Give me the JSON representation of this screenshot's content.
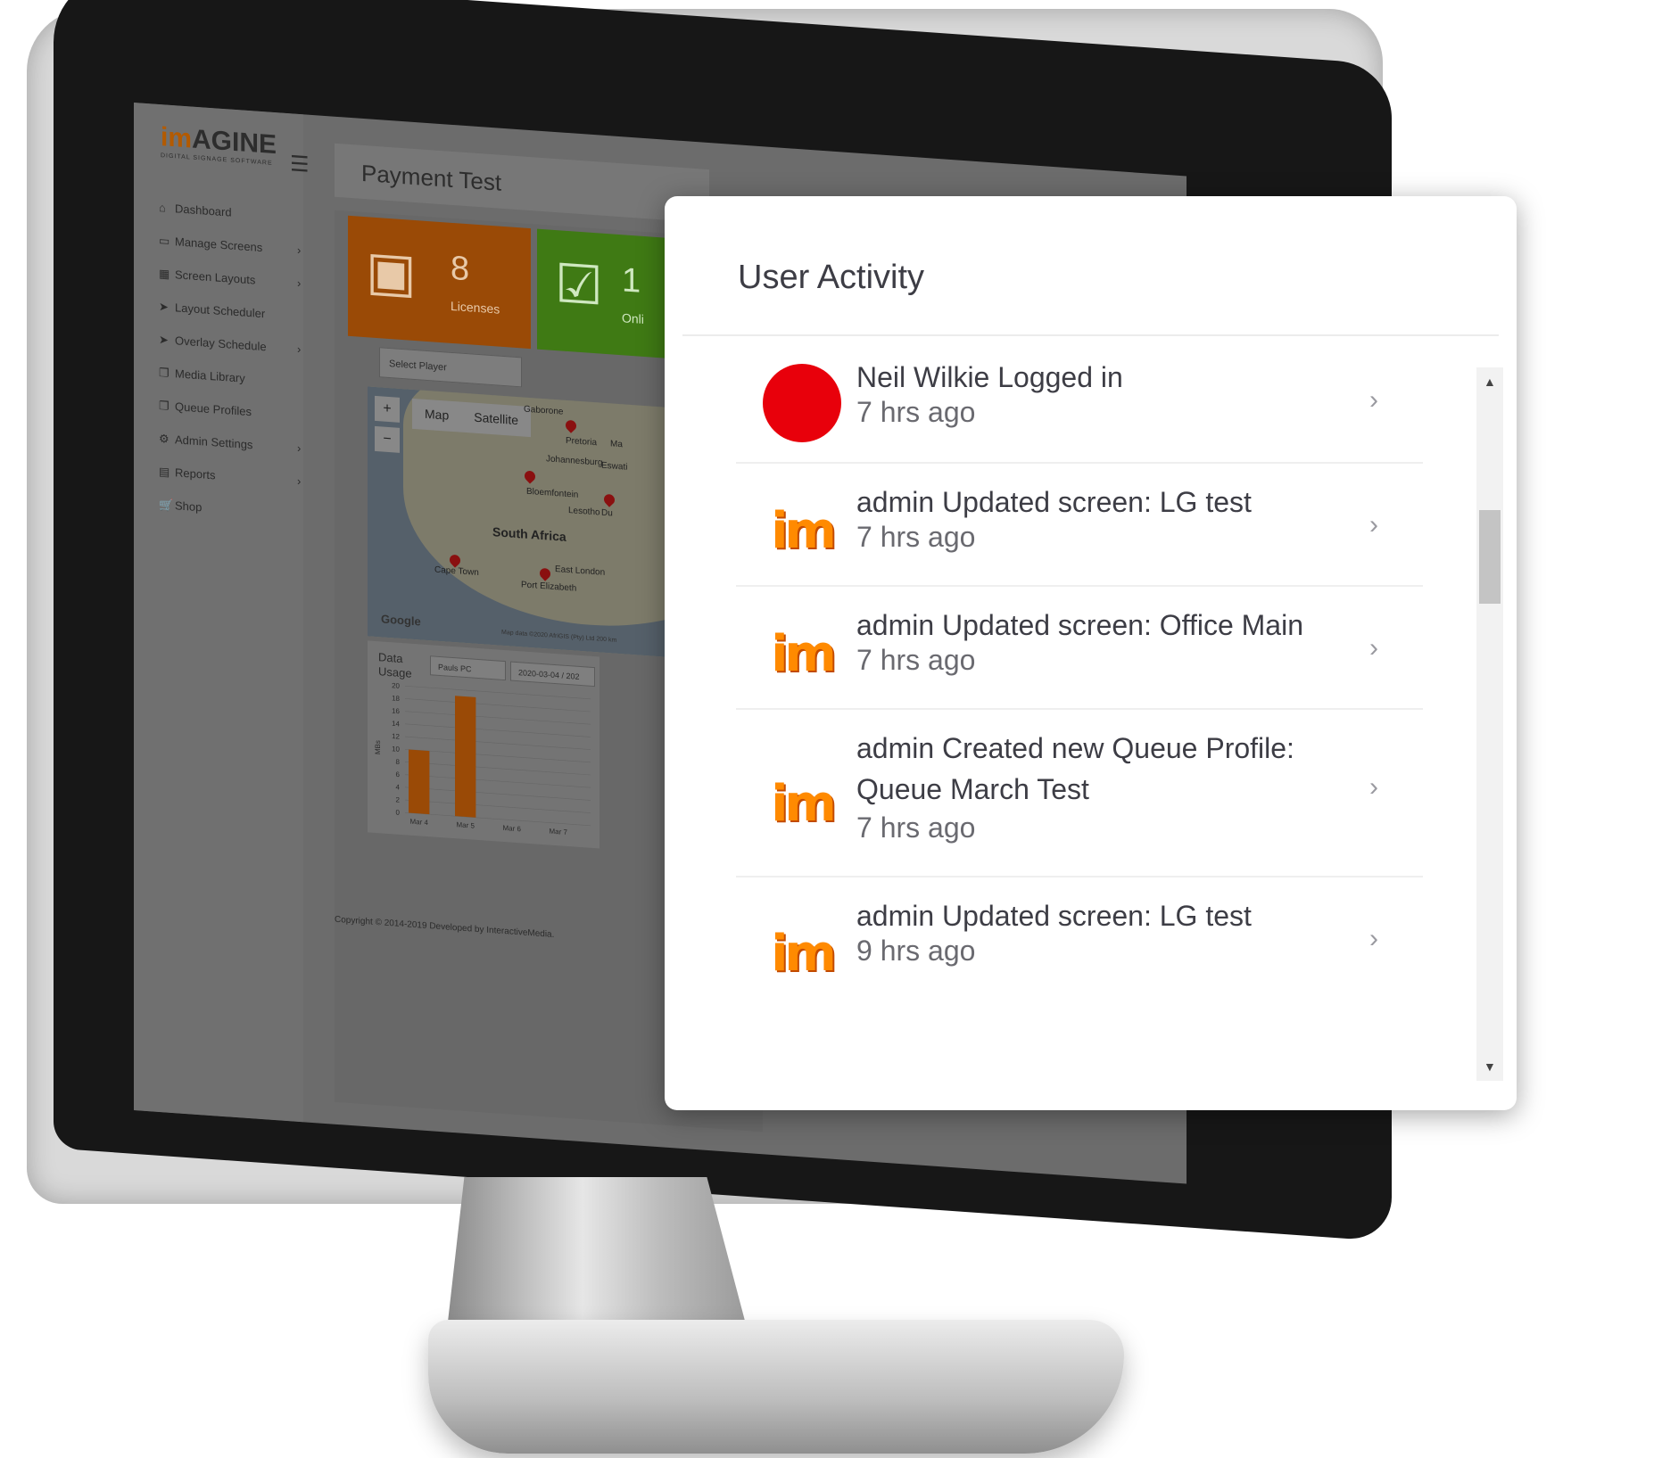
{
  "app": {
    "logo": "AGINE",
    "logo_prefix": "im",
    "logo_sub": "DIGITAL SIGNAGE SOFTWARE"
  },
  "sidebar": {
    "items": [
      {
        "label": "Dashboard",
        "icon": "home-icon",
        "has_chevron": false
      },
      {
        "label": "Manage Screens",
        "icon": "monitor-icon",
        "has_chevron": true
      },
      {
        "label": "Screen Layouts",
        "icon": "layout-icon",
        "has_chevron": true
      },
      {
        "label": "Layout Scheduler",
        "icon": "send-icon",
        "has_chevron": false
      },
      {
        "label": "Overlay Schedule",
        "icon": "send-icon",
        "has_chevron": true
      },
      {
        "label": "Media Library",
        "icon": "copy-icon",
        "has_chevron": false
      },
      {
        "label": "Queue Profiles",
        "icon": "copy-icon",
        "has_chevron": false
      },
      {
        "label": "Admin Settings",
        "icon": "gear-icon",
        "has_chevron": true
      },
      {
        "label": "Reports",
        "icon": "report-icon",
        "has_chevron": true
      },
      {
        "label": "Shop",
        "icon": "cart-icon",
        "has_chevron": false
      }
    ]
  },
  "page": {
    "title": "Payment Test"
  },
  "tiles": [
    {
      "value": "8",
      "label": "Licenses",
      "color": "#9a4a06"
    },
    {
      "value": "1",
      "label": "Onli",
      "color": "#3f7a14"
    }
  ],
  "player_select": {
    "value": "Select Player"
  },
  "map": {
    "type_options": [
      "Map",
      "Satellite"
    ],
    "country": "South Africa",
    "places": [
      "Gaborone",
      "Pretoria",
      "Johannesburg",
      "Eswati",
      "Bloemfontein",
      "Lesotho",
      "Du",
      "Cape Town",
      "Port Elizabeth",
      "East London",
      "Ma"
    ],
    "provider": "Google",
    "attribution": "Map data ©2020 AfriGIS (Pty) Ltd   200 km"
  },
  "data_usage": {
    "title": "Data Usage",
    "player": "Pauls PC",
    "date_range": "2020-03-04 / 202"
  },
  "chart_data": {
    "type": "bar",
    "categories": [
      "Mar 4",
      "Mar 5",
      "Mar 6",
      "Mar 7"
    ],
    "values": [
      10,
      19,
      0,
      0
    ],
    "ylabel": "MBs",
    "ylim": [
      0,
      20
    ],
    "yticks": [
      0,
      2,
      4,
      6,
      8,
      10,
      12,
      14,
      16,
      18,
      20
    ],
    "color": "#9a4a06"
  },
  "footer": {
    "copyright": "Copyright © 2014-2019 Developed by InteractiveMedia."
  },
  "user_activity": {
    "title": "User Activity",
    "items": [
      {
        "avatar": "red-dot-avatar",
        "title": "Neil Wilkie Logged in",
        "time": "7 hrs ago"
      },
      {
        "avatar": "im-logo-avatar",
        "title": "admin Updated screen: LG test",
        "time": "7 hrs ago"
      },
      {
        "avatar": "im-logo-avatar",
        "title": "admin Updated screen: Office Main",
        "time": "7 hrs ago"
      },
      {
        "avatar": "im-logo-avatar",
        "title": "admin Created new Queue Profile: Queue March Test",
        "time": "7 hrs ago"
      },
      {
        "avatar": "im-logo-avatar",
        "title": "admin Updated screen: LG test",
        "time": "9 hrs ago"
      }
    ],
    "avatar_logo_text": "im",
    "accent_color": "#e8000b"
  }
}
